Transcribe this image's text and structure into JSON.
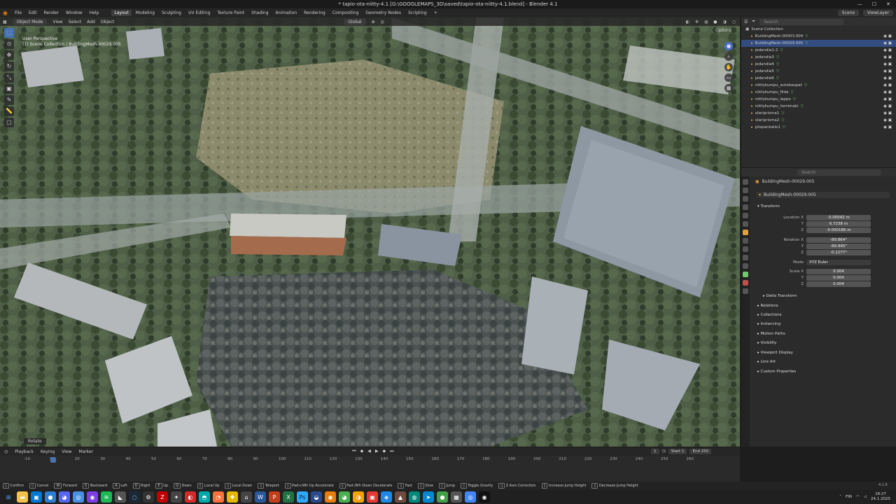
{
  "title": "* tapio-ota-niitty-4.1 [G:\\GOOGLEMAPS_3D\\saved\\tapio-ota-niitty-4.1.blend] - Blender 4.1",
  "menu": [
    "File",
    "Edit",
    "Render",
    "Window",
    "Help"
  ],
  "workspaces": [
    "Layout",
    "Modeling",
    "Sculpting",
    "UV Editing",
    "Texture Paint",
    "Shading",
    "Animation",
    "Rendering",
    "Compositing",
    "Geometry Nodes",
    "Scripting"
  ],
  "scene": "Scene",
  "view_layer": "ViewLayer",
  "viewport": {
    "mode": "Object Mode",
    "menus": [
      "View",
      "Select",
      "Add",
      "Object"
    ],
    "orientation": "Global",
    "options": "Options",
    "info_line1": "User Perspective",
    "info_line2": "(1) Scene Collection | BuildingMesh-00029.005",
    "rotate_label": "Rotate"
  },
  "outliner": {
    "search_placeholder": "Search",
    "root": "Scene Collection",
    "items": [
      {
        "name": "BuildingMesh-00003.004",
        "selected": false
      },
      {
        "name": "BuildingMesh-00029.005",
        "selected": true
      },
      {
        "name": "jedandia1-2",
        "selected": false
      },
      {
        "name": "jedandia3",
        "selected": false
      },
      {
        "name": "jedandia4",
        "selected": false
      },
      {
        "name": "jedandia5",
        "selected": false
      },
      {
        "name": "jedandia6",
        "selected": false
      },
      {
        "name": "niittykumpu_autokaupat",
        "selected": false
      },
      {
        "name": "niittykumpu_fiida",
        "selected": false
      },
      {
        "name": "niittykumpu_lappo",
        "selected": false
      },
      {
        "name": "niittykumpu_tornimaki",
        "selected": false
      },
      {
        "name": "olariprisma1",
        "selected": false
      },
      {
        "name": "olariprisma2",
        "selected": false
      },
      {
        "name": "piispankalio1",
        "selected": false
      }
    ]
  },
  "properties": {
    "object_name": "BuildingMesh-00029.005",
    "data_name": "BuildingMesh-00029.005",
    "transform_label": "Transform",
    "location": {
      "label": "Location X",
      "x": "-0.00042 m",
      "y": "6.7238 m",
      "z": "-0.000186 m"
    },
    "rotation": {
      "label": "Rotation X",
      "x": "-89.864°",
      "y": "-89.995°",
      "z": "-0.1277°"
    },
    "mode_label": "Mode",
    "mode": "XYZ Euler",
    "scale": {
      "label": "Scale X",
      "x": "0.004",
      "y": "0.004",
      "z": "0.004"
    },
    "axis_y": "Y",
    "axis_z": "Z",
    "sections": [
      "Delta Transform",
      "Relations",
      "Collections",
      "Instancing",
      "Motion Paths",
      "Visibility",
      "Viewport Display",
      "Line Art",
      "Custom Properties"
    ]
  },
  "timeline": {
    "menus": [
      "Playback",
      "Keying",
      "View",
      "Marker"
    ],
    "ticks": [
      "-10",
      "10",
      "20",
      "30",
      "40",
      "50",
      "60",
      "70",
      "80",
      "90",
      "100",
      "110",
      "120",
      "130",
      "140",
      "150",
      "160",
      "170",
      "180",
      "190",
      "200",
      "210",
      "220",
      "230",
      "240",
      "250",
      "260"
    ],
    "current_frame": "1",
    "start_label": "Start",
    "start": "1",
    "end_label": "End",
    "end": "250"
  },
  "status": [
    {
      "key": "",
      "text": "Confirm"
    },
    {
      "key": "",
      "text": "Cancel"
    },
    {
      "key": "W",
      "text": "Forward"
    },
    {
      "key": "S",
      "text": "Backward"
    },
    {
      "key": "A",
      "text": "Left"
    },
    {
      "key": "D",
      "text": "Right"
    },
    {
      "key": "E",
      "text": "Up"
    },
    {
      "key": "Q",
      "text": "Down"
    },
    {
      "key": "",
      "text": "Local Up"
    },
    {
      "key": "",
      "text": "Local Down"
    },
    {
      "key": "",
      "text": "Teleport"
    },
    {
      "key": "",
      "text": "Pad+/Wh Up Accelerate"
    },
    {
      "key": "",
      "text": "Pad-/Wh Down Decelerate"
    },
    {
      "key": "",
      "text": "Fast"
    },
    {
      "key": "",
      "text": "Slow"
    },
    {
      "key": "",
      "text": "Jump"
    },
    {
      "key": "",
      "text": "Toggle Gravity"
    },
    {
      "key": "",
      "text": "Z Axis Correction"
    },
    {
      "key": "",
      "text": "Increase Jump Height"
    },
    {
      "key": "",
      "text": "Decrease Jump Height"
    }
  ],
  "version": "4.1.0",
  "tray": {
    "lang": "FIN",
    "time": "18:27",
    "date": "24.1.2025"
  },
  "colors": {
    "accent": "#4772b3",
    "selected": "#334d80",
    "header": "#262626"
  }
}
